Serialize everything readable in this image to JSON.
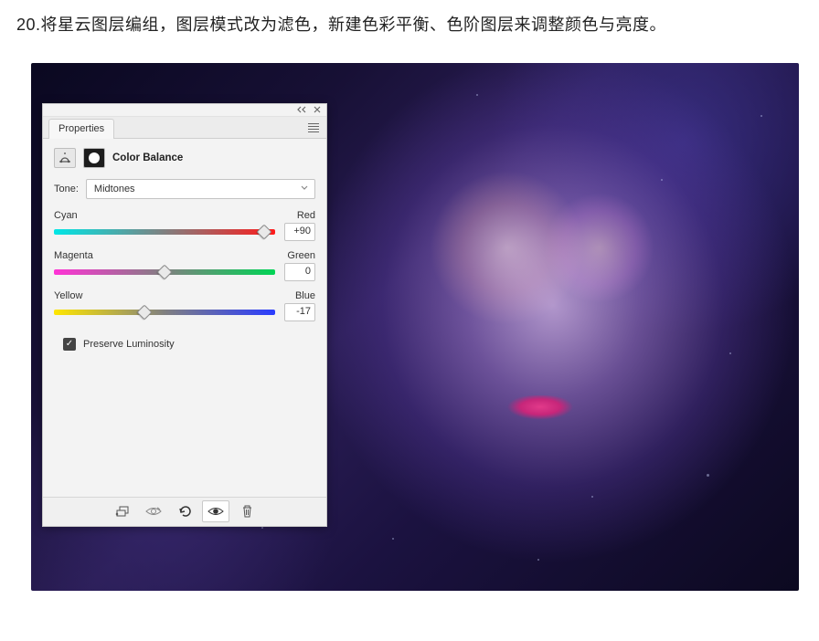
{
  "instruction_text": "20.将星云图层编组，图层模式改为滤色，新建色彩平衡、色阶图层来调整颜色与亮度。",
  "panel": {
    "tab_label": "Properties",
    "adjustment_title": "Color Balance",
    "tone_label": "Tone:",
    "tone_value": "Midtones",
    "sliders": {
      "cr": {
        "left": "Cyan",
        "right": "Red",
        "value": "+90",
        "pos_pct": 95
      },
      "mg": {
        "left": "Magenta",
        "right": "Green",
        "value": "0",
        "pos_pct": 50
      },
      "yb": {
        "left": "Yellow",
        "right": "Blue",
        "value": "-17",
        "pos_pct": 41
      }
    },
    "preserve_label": "Preserve Luminosity",
    "preserve_checked": true,
    "footer_icons": [
      "clip-to-layer",
      "view-previous",
      "reset",
      "toggle-visibility",
      "delete"
    ]
  }
}
